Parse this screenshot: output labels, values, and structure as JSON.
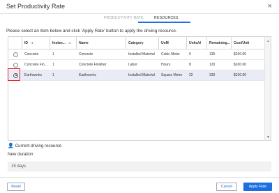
{
  "dialog": {
    "title": "Set Productivity Rate",
    "close_glyph": "×"
  },
  "tabs": [
    {
      "label": "PRODUCTIVITY RATE",
      "active": false
    },
    {
      "label": "RESOURCES",
      "active": true
    }
  ],
  "instruction": "Please select an item below and click 'Apply Rate' button to apply the driving resource.",
  "table": {
    "columns": [
      {
        "label": "ID",
        "sort": "↑1"
      },
      {
        "label": "Instan...",
        "sort": "↑2"
      },
      {
        "label": "Name",
        "sort": ""
      },
      {
        "label": "Category",
        "sort": ""
      },
      {
        "label": "UoM",
        "sort": ""
      },
      {
        "label": "Units/d",
        "sort": ""
      },
      {
        "label": "Remaining...",
        "sort": ""
      },
      {
        "label": "Cost/Unit",
        "sort": ""
      }
    ],
    "rows": [
      {
        "selected": false,
        "id": "Concrete",
        "instance": "1",
        "name": "Concrete",
        "category": "Installed Material",
        "uom": "Cubic Meter",
        "units": "9",
        "remaining": "135",
        "cost": "$100.00"
      },
      {
        "selected": false,
        "id": "Concrete Fin...",
        "instance": "1",
        "name": "Concrete Finisher",
        "category": "Labor",
        "uom": "Hours",
        "units": "8",
        "remaining": "120",
        "cost": "$100.00"
      },
      {
        "selected": true,
        "id": "Earthworks",
        "instance": "1",
        "name": "Earthworks",
        "category": "Installed Material",
        "uom": "Square Meter",
        "units": "22",
        "remaining": "330",
        "cost": "$100.00"
      }
    ]
  },
  "driving_resource": {
    "icon": "person-icon",
    "label": "Current driving resource"
  },
  "new_duration": {
    "label": "New duration",
    "value": "15 days"
  },
  "buttons": {
    "reset": "Reset",
    "cancel": "Cancel",
    "apply": "Apply Rate"
  },
  "colors": {
    "accent": "#1d6fe0",
    "selected_row": "#e9ecf6",
    "highlight_border": "#e0242c"
  }
}
